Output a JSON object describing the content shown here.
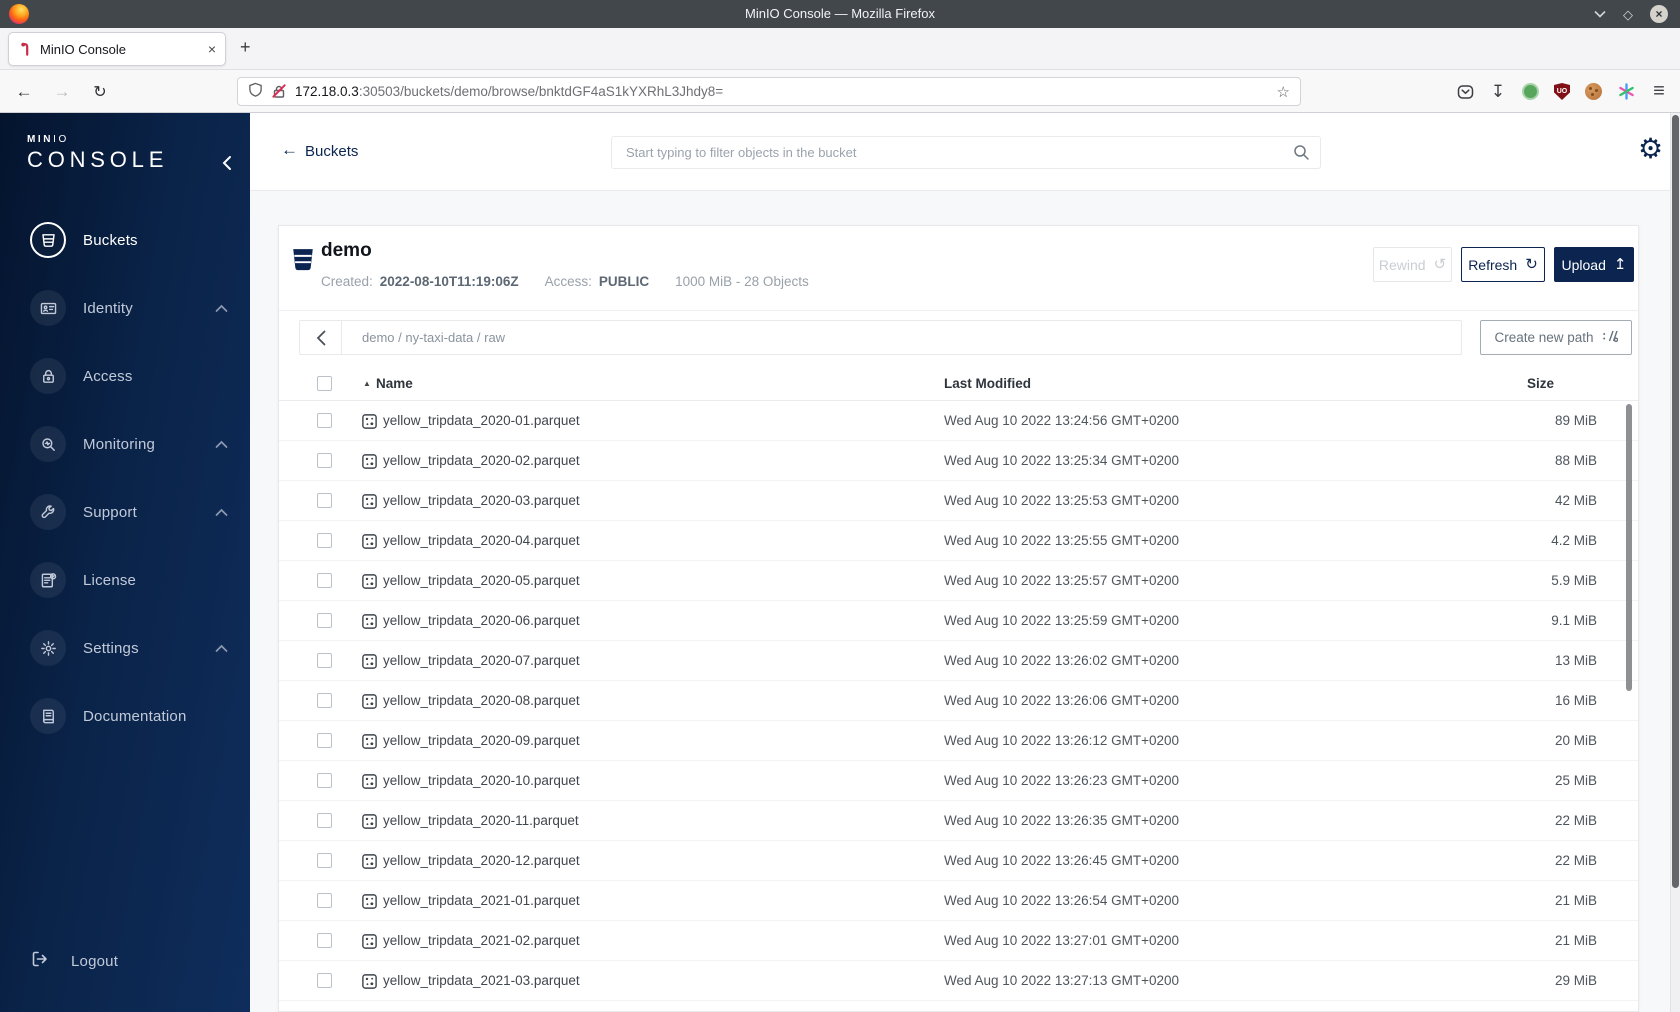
{
  "window": {
    "title": "MinIO Console — Mozilla Firefox"
  },
  "browser": {
    "tab_title": "MinIO Console",
    "url_domain": "172.18.0.3",
    "url_rest": ":30503/buckets/demo/browse/bnktdGF4aS1kYXRhL3Jhdy8="
  },
  "icons": {
    "plus": "+",
    "close": "×",
    "diamond": "◇",
    "back": "←",
    "forward": "→",
    "reload": "↻",
    "star": "☆",
    "download": "↧",
    "hamburger": "≡",
    "gear": "⚙",
    "rewind": "↺",
    "refresh": "↻",
    "upload": "↥",
    "sort_asc": "▲",
    "ublock_text": "UO"
  },
  "sidebar": {
    "brand_line1_bold": "MIN",
    "brand_line1_light": "IO",
    "brand_line2": "CONSOLE",
    "items": [
      {
        "label": "Buckets",
        "icon": "bucket",
        "active": true,
        "expandable": false
      },
      {
        "label": "Identity",
        "icon": "identity",
        "active": false,
        "expandable": true
      },
      {
        "label": "Access",
        "icon": "access",
        "active": false,
        "expandable": false
      },
      {
        "label": "Monitoring",
        "icon": "monitoring",
        "active": false,
        "expandable": true
      },
      {
        "label": "Support",
        "icon": "support",
        "active": false,
        "expandable": true
      },
      {
        "label": "License",
        "icon": "license",
        "active": false,
        "expandable": false
      },
      {
        "label": "Settings",
        "icon": "settings",
        "active": false,
        "expandable": true
      },
      {
        "label": "Documentation",
        "icon": "documentation",
        "active": false,
        "expandable": false
      }
    ],
    "logout_label": "Logout"
  },
  "topbar": {
    "back_label": "Buckets",
    "search_placeholder": "Start typing to filter objects in the bucket"
  },
  "bucket": {
    "name": "demo",
    "created_label": "Created:",
    "created_value": "2022-08-10T11:19:06Z",
    "access_label": "Access:",
    "access_value": "PUBLIC",
    "usage": "1000 MiB - 28 Objects",
    "rewind_label": "Rewind",
    "refresh_label": "Refresh",
    "upload_label": "Upload"
  },
  "pathbar": {
    "path": "demo / ny-taxi-data / raw",
    "create_label": "Create new path"
  },
  "table": {
    "columns": {
      "name": "Name",
      "modified": "Last Modified",
      "size": "Size"
    },
    "rows": [
      {
        "name": "yellow_tripdata_2020-01.parquet",
        "modified": "Wed Aug 10 2022 13:24:56 GMT+0200",
        "size": "89 MiB"
      },
      {
        "name": "yellow_tripdata_2020-02.parquet",
        "modified": "Wed Aug 10 2022 13:25:34 GMT+0200",
        "size": "88 MiB"
      },
      {
        "name": "yellow_tripdata_2020-03.parquet",
        "modified": "Wed Aug 10 2022 13:25:53 GMT+0200",
        "size": "42 MiB"
      },
      {
        "name": "yellow_tripdata_2020-04.parquet",
        "modified": "Wed Aug 10 2022 13:25:55 GMT+0200",
        "size": "4.2 MiB"
      },
      {
        "name": "yellow_tripdata_2020-05.parquet",
        "modified": "Wed Aug 10 2022 13:25:57 GMT+0200",
        "size": "5.9 MiB"
      },
      {
        "name": "yellow_tripdata_2020-06.parquet",
        "modified": "Wed Aug 10 2022 13:25:59 GMT+0200",
        "size": "9.1 MiB"
      },
      {
        "name": "yellow_tripdata_2020-07.parquet",
        "modified": "Wed Aug 10 2022 13:26:02 GMT+0200",
        "size": "13 MiB"
      },
      {
        "name": "yellow_tripdata_2020-08.parquet",
        "modified": "Wed Aug 10 2022 13:26:06 GMT+0200",
        "size": "16 MiB"
      },
      {
        "name": "yellow_tripdata_2020-09.parquet",
        "modified": "Wed Aug 10 2022 13:26:12 GMT+0200",
        "size": "20 MiB"
      },
      {
        "name": "yellow_tripdata_2020-10.parquet",
        "modified": "Wed Aug 10 2022 13:26:23 GMT+0200",
        "size": "25 MiB"
      },
      {
        "name": "yellow_tripdata_2020-11.parquet",
        "modified": "Wed Aug 10 2022 13:26:35 GMT+0200",
        "size": "22 MiB"
      },
      {
        "name": "yellow_tripdata_2020-12.parquet",
        "modified": "Wed Aug 10 2022 13:26:45 GMT+0200",
        "size": "22 MiB"
      },
      {
        "name": "yellow_tripdata_2021-01.parquet",
        "modified": "Wed Aug 10 2022 13:26:54 GMT+0200",
        "size": "21 MiB"
      },
      {
        "name": "yellow_tripdata_2021-02.parquet",
        "modified": "Wed Aug 10 2022 13:27:01 GMT+0200",
        "size": "21 MiB"
      },
      {
        "name": "yellow_tripdata_2021-03.parquet",
        "modified": "Wed Aug 10 2022 13:27:13 GMT+0200",
        "size": "29 MiB"
      }
    ]
  },
  "colors": {
    "navy": "#0b2550",
    "brand_red": "#C72C48"
  }
}
